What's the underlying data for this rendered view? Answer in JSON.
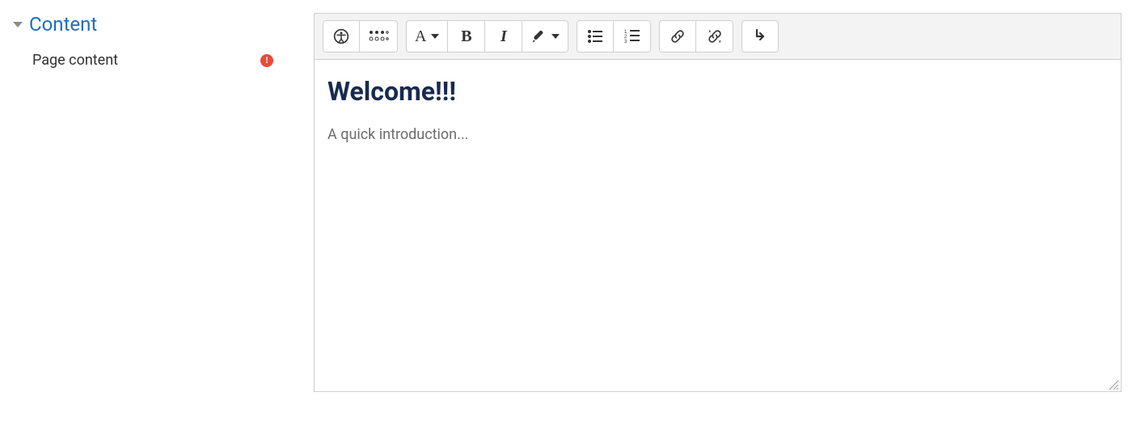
{
  "section": {
    "title": "Content"
  },
  "field": {
    "label": "Page content",
    "required_badge": "!"
  },
  "editor": {
    "heading": "Welcome!!!",
    "paragraph": "A quick introduction..."
  }
}
